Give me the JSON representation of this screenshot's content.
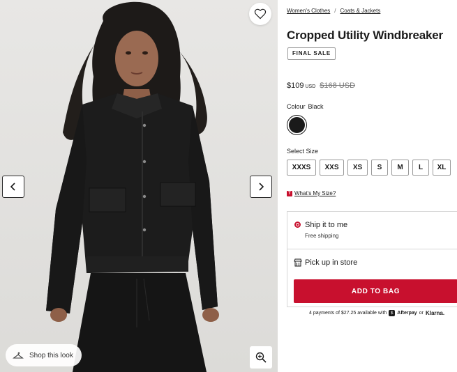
{
  "gallery": {
    "shop_look_label": "Shop this look",
    "icons": [
      "heart-icon",
      "chevron-left-icon",
      "chevron-right-icon",
      "zoom-in-icon",
      "hanger-icon"
    ]
  },
  "breadcrumb": {
    "items": [
      "Women's Clothes",
      "Coats & Jackets"
    ],
    "separator": "/"
  },
  "product": {
    "title": "Cropped Utility Windbreaker",
    "badge": "FINAL SALE",
    "price": "$109",
    "currency": "USD",
    "original_price": "$168 USD"
  },
  "colour": {
    "label": "Colour",
    "value": "Black",
    "swatch_color": "#1a1a1a"
  },
  "size": {
    "label": "Select Size",
    "options": [
      "XXXS",
      "XXS",
      "XS",
      "S",
      "M",
      "L",
      "XL"
    ],
    "guide_label": "What's My Size?",
    "guide_badge": "T"
  },
  "shipping": {
    "ship_title": "Ship it to me",
    "ship_subtitle": "Free shipping",
    "pickup_label": "Pick up in store",
    "selected": "ship"
  },
  "cta": {
    "add_to_bag": "ADD TO BAG",
    "accent_color": "#c8102e"
  },
  "payments": {
    "text": "4 payments of $27.25 available with",
    "afterpay_icon": "$",
    "afterpay": "Afterpay",
    "or": "or",
    "klarna": "Klarna."
  }
}
